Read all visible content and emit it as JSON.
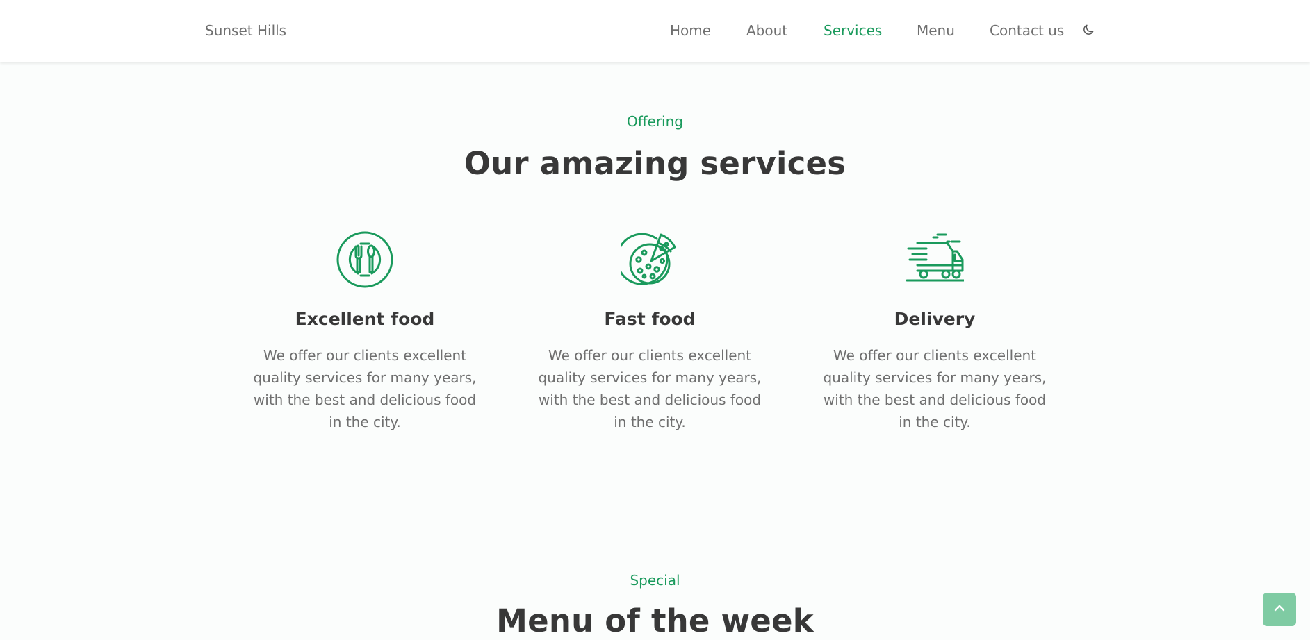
{
  "header": {
    "logo": "Sunset Hills",
    "nav": [
      {
        "label": "Home"
      },
      {
        "label": "About"
      },
      {
        "label": "Services"
      },
      {
        "label": "Menu"
      },
      {
        "label": "Contact us"
      }
    ],
    "active_nav": "Services",
    "theme_icon": "moon-icon"
  },
  "services": {
    "subtitle": "Offering",
    "title": "Our amazing services",
    "cards": [
      {
        "icon": "dining-plate-icon",
        "title": "Excellent food",
        "text": "We offer our clients excellent quality services for many years, with the best and delicious food in the city."
      },
      {
        "icon": "pizza-icon",
        "title": "Fast food",
        "text": "We offer our clients excellent quality services for many years, with the best and delicious food in the city."
      },
      {
        "icon": "delivery-truck-icon",
        "title": "Delivery",
        "text": "We offer our clients excellent quality services for many years, with the best and delicious food in the city."
      }
    ]
  },
  "menu": {
    "subtitle": "Special",
    "title": "Menu of the week"
  },
  "scroll_up_icon": "chevron-up-icon",
  "colors": {
    "accent": "#1a9a5c",
    "title": "#383838",
    "text": "#6f6f6f",
    "background": "#fbfdfc",
    "scroll_button": "#7fcba3"
  }
}
